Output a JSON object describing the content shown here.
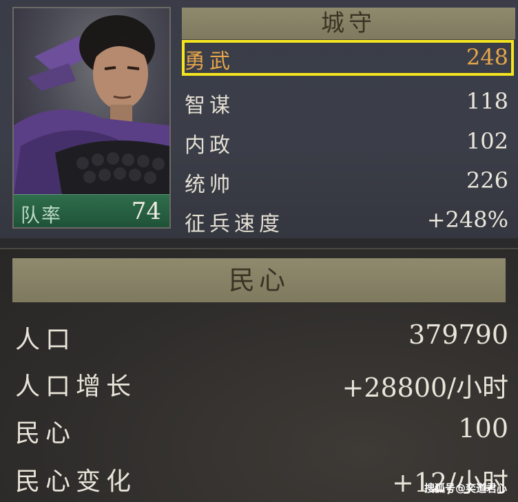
{
  "general": {
    "troop_label": "队率",
    "troop_value": "74"
  },
  "city_defense": {
    "header": "城守",
    "stats": [
      {
        "label": "勇武",
        "value": "248",
        "highlighted": true
      },
      {
        "label": "智谋",
        "value": "118"
      },
      {
        "label": "内政",
        "value": "102"
      },
      {
        "label": "统帅",
        "value": "226"
      },
      {
        "label": "征兵速度",
        "value": "+248%"
      }
    ]
  },
  "morale": {
    "header": "民心",
    "rows": [
      {
        "label": "人口",
        "value": "379790"
      },
      {
        "label": "人口增长",
        "value": "+28800/小时"
      },
      {
        "label": "民心",
        "value": "100"
      },
      {
        "label": "民心变化",
        "value": "+12/小时"
      }
    ]
  },
  "watermark": "搜狐号@奕道君心",
  "colors": {
    "highlight_border": "#f5e51f",
    "highlight_text": "#e6a54a",
    "header_bg": "#8f8a6e",
    "troop_bar": "#2f6e4c"
  }
}
